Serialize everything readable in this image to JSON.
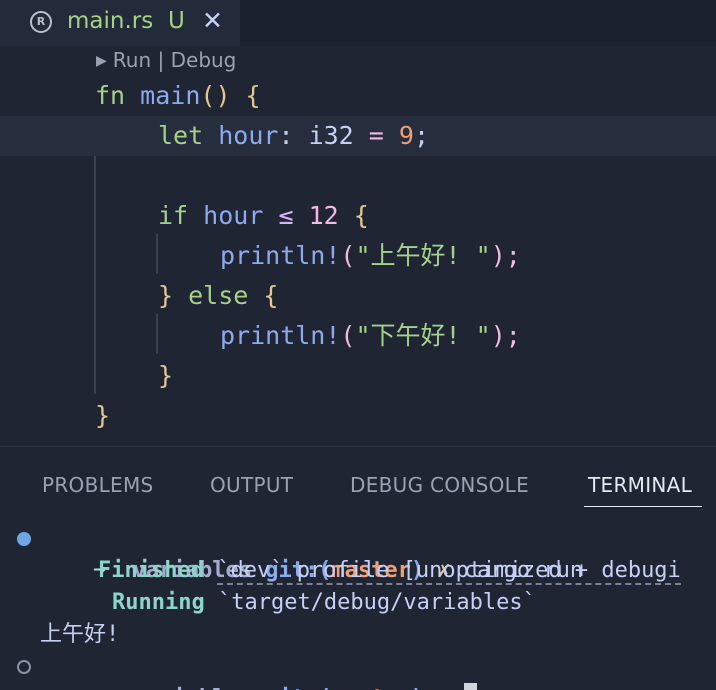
{
  "tab": {
    "icon": "rust-icon",
    "title": "main.rs",
    "modified_marker": "U",
    "close_glyph": "✕"
  },
  "codelens": {
    "run": "Run",
    "separator": "|",
    "debug": "Debug"
  },
  "code": {
    "line1": {
      "kw": "fn",
      "name": "main",
      "rest": "() {"
    },
    "line2": {
      "kw": "let",
      "var": "hour",
      "colon": ":",
      "type": "i32",
      "eq": "=",
      "value": "9",
      "semi": ";"
    },
    "line4": {
      "kw": "if",
      "var": "hour",
      "op": "≤",
      "value": "12",
      "brace": "{"
    },
    "line5": {
      "macro": "println!",
      "open": "(",
      "string": "\"上午好! \"",
      "close": ");"
    },
    "line6": {
      "close": "}",
      "kw": "else",
      "open": "{"
    },
    "line7": {
      "macro": "println!",
      "open": "(",
      "string": "\"下午好! \"",
      "close": ");"
    },
    "line8": {
      "close": "}"
    },
    "line9": {
      "close": "}"
    }
  },
  "panel": {
    "tabs": [
      "PROBLEMS",
      "OUTPUT",
      "DEBUG CONSOLE",
      "TERMINAL"
    ],
    "active_tab": "TERMINAL"
  },
  "terminal": {
    "prompt_arrow": "➜",
    "dir": "variables",
    "git_prefix": "git:(",
    "branch": "master",
    "git_suffix": ")",
    "dirty_mark": "✗",
    "command": "cargo run",
    "finished_label": "Finished",
    "finished_text": "`dev` profile [unoptimized + debugi",
    "running_label": "Running",
    "running_text": "`target/debug/variables`",
    "output": "上午好!"
  },
  "colors": {
    "background": "#1f2533",
    "keyword": "#a6d189",
    "function": "#8caaee",
    "number": "#ef9f76",
    "brace": "#e5c890"
  }
}
